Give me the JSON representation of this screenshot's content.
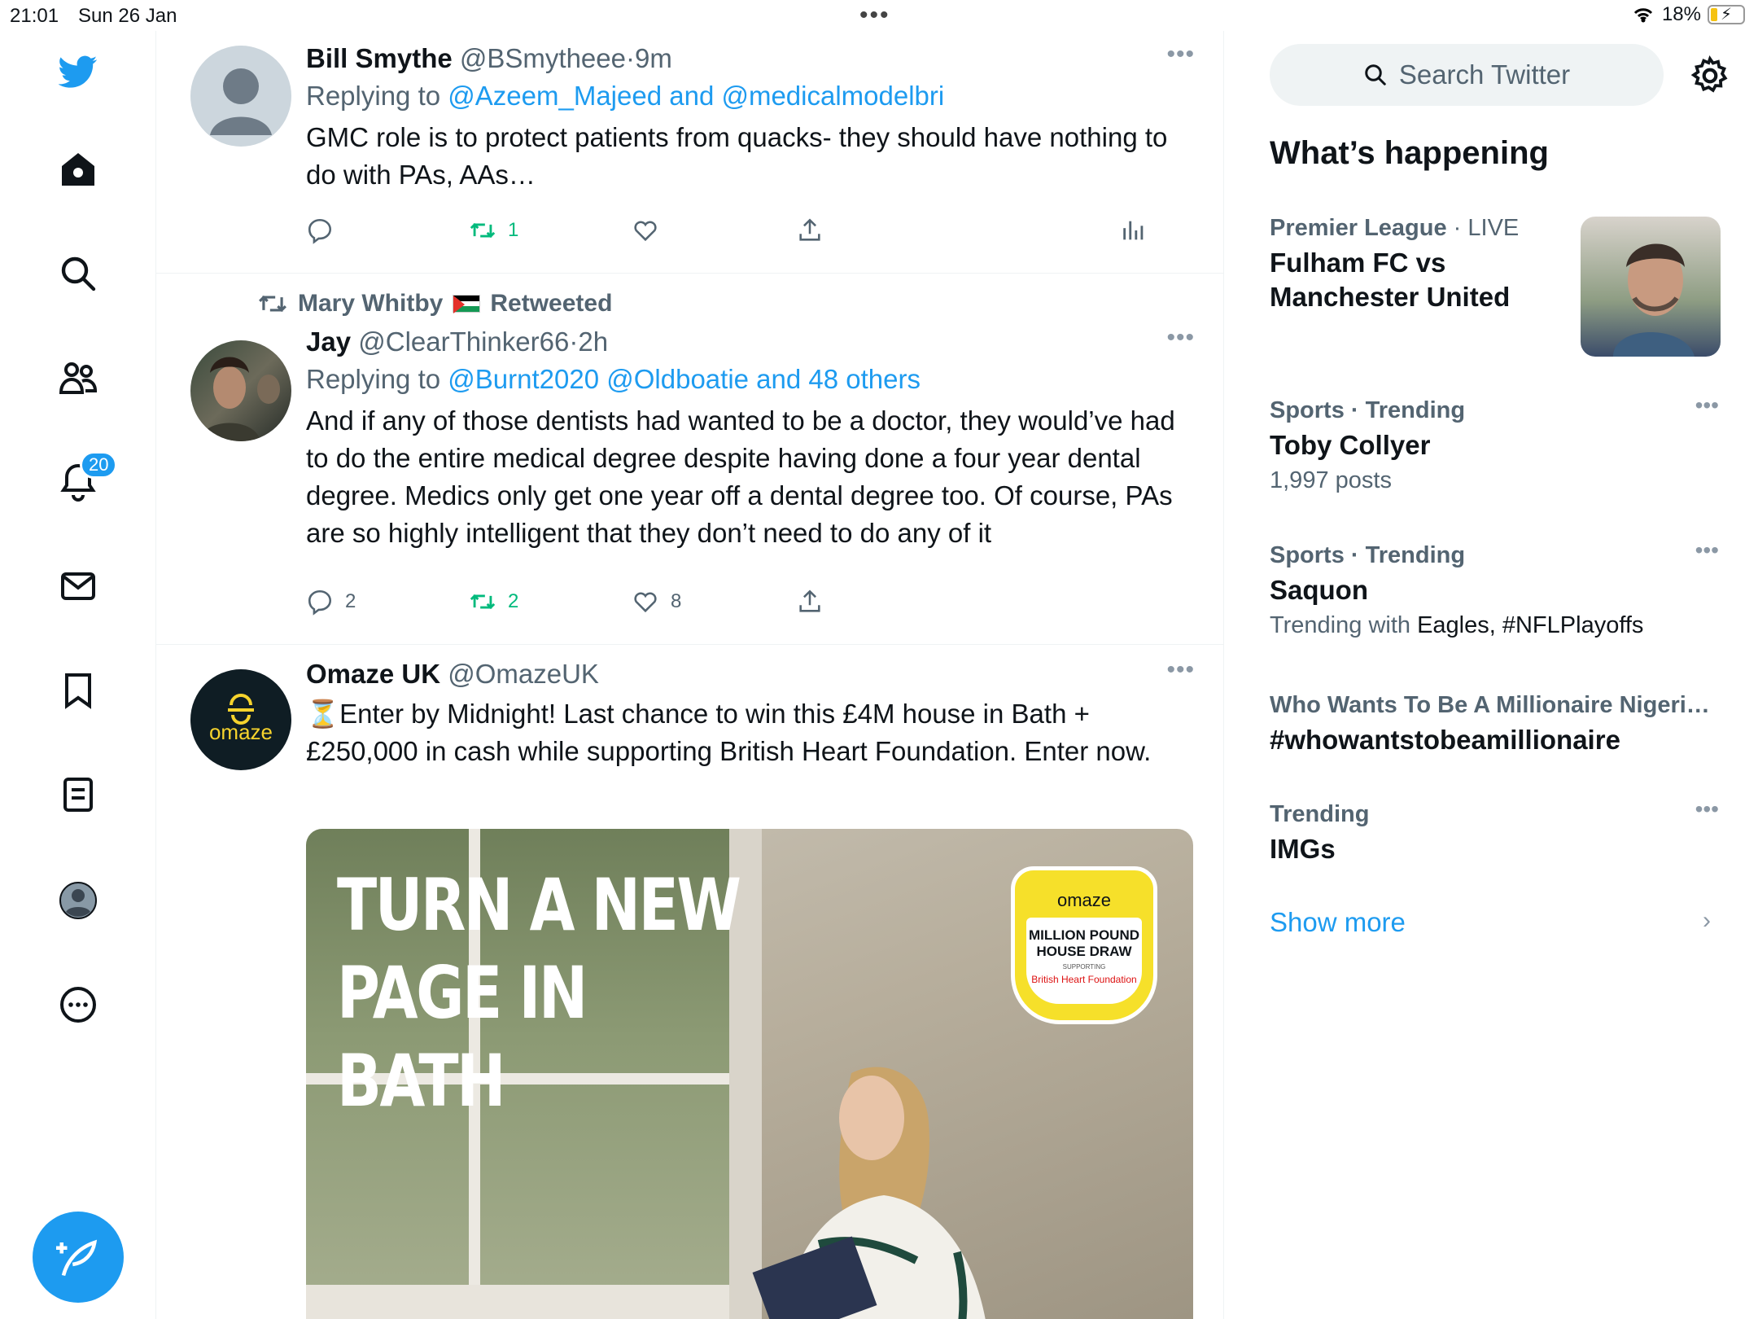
{
  "status_bar": {
    "time": "21:01",
    "date": "Sun 26 Jan",
    "battery": "18%"
  },
  "nav": {
    "notifications_badge": "20"
  },
  "tweets": [
    {
      "name": "Bill Smythe",
      "handle": "@BSmytheee",
      "sep": "·",
      "ago": "9m",
      "reply_prefix": "Replying to",
      "reply_to": "@Azeem_Majeed and @medicalmodelbri",
      "text": "GMC role is to protect patients from quacks- they should have nothing to do with PAs, AAs…",
      "retweets": "1"
    },
    {
      "retweeted_by": "Mary Whitby",
      "retweeted_label": "Retweeted",
      "name": "Jay",
      "handle": "@ClearThinker66",
      "sep": "·",
      "ago": "2h",
      "reply_prefix": "Replying to",
      "reply_to": "@Burnt2020 @Oldboatie and 48 others",
      "text": "And if any of those dentists had wanted to be a doctor, they would’ve had to do the entire medical degree despite having done a four year dental degree. Medics only get one year off a dental degree too. Of course, PAs are so highly intelligent that they don’t need to do any of it",
      "replies": "2",
      "retweets": "2",
      "likes": "8"
    },
    {
      "name": "Omaze UK",
      "handle": "@OmazeUK",
      "avatar_text": "omaze",
      "text": "⏳Enter by Midnight! Last chance to win this £4M house in Bath + £250,000 in cash while supporting British Heart Foundation. Enter now.",
      "ad_headline": [
        "TURN A NEW",
        "PAGE IN",
        "BATH"
      ],
      "badge_brand": "omaze",
      "badge_title": "MILLION POUND HOUSE DRAW",
      "badge_sub": "SUPPORTING",
      "badge_charity": "British Heart Foundation"
    }
  ],
  "sidebar": {
    "search_placeholder": "Search Twitter",
    "whats_happening": "What’s happening",
    "trends": [
      {
        "context": "Premier League",
        "live": "LIVE",
        "sep": "·",
        "title": "Fulham FC vs Manchester United"
      },
      {
        "context": "Sports · Trending",
        "title": "Toby Collyer",
        "count": "1,997 posts"
      },
      {
        "context": "Sports · Trending",
        "title": "Saquon",
        "trending_with_label": "Trending with",
        "trending_with": "Eagles, #NFLPlayoffs"
      },
      {
        "context": "Who Wants To Be A Millionaire Nigeri…",
        "title": "#whowantstobeamillionaire"
      },
      {
        "context": "Trending",
        "title": "IMGs"
      }
    ],
    "show_more": "Show more"
  }
}
